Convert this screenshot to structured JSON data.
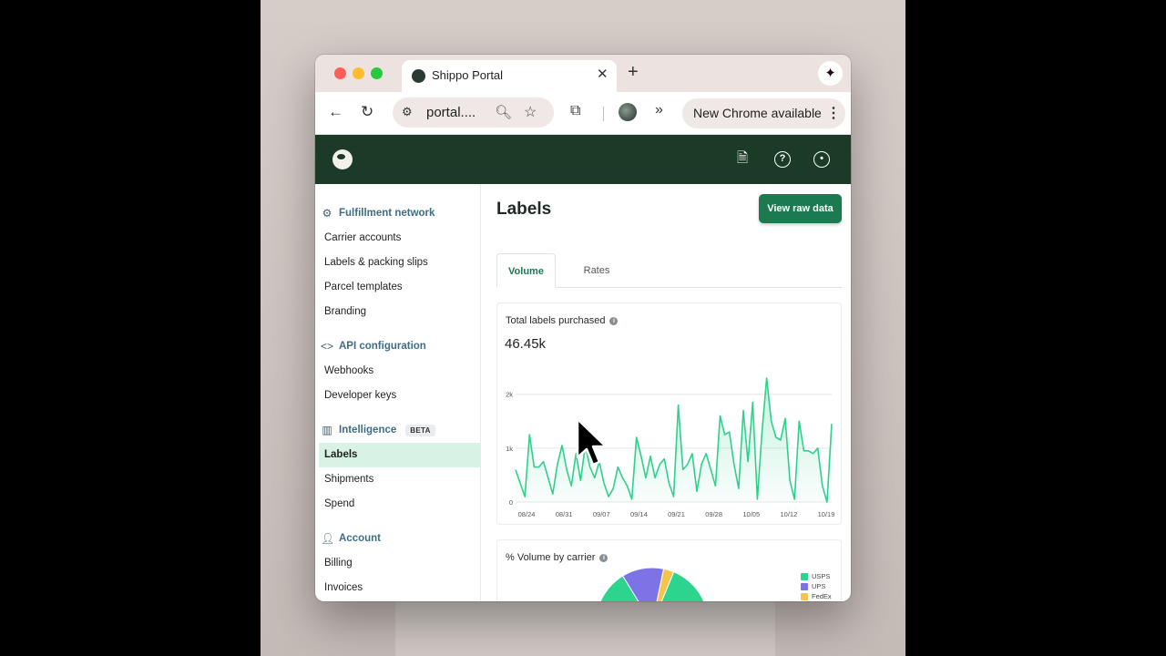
{
  "browser": {
    "tab_title": "Shippo Portal",
    "tab_close": "✕",
    "new_tab": "+",
    "url": "portal....",
    "update_pill": "New Chrome available",
    "menu": "⋮"
  },
  "sidebar": {
    "sections": [
      {
        "label": "Fulfillment network",
        "items": [
          "Carrier accounts",
          "Labels & packing slips",
          "Parcel templates",
          "Branding"
        ]
      },
      {
        "label": "API configuration",
        "items": [
          "Webhooks",
          "Developer keys"
        ]
      },
      {
        "label": "Intelligence",
        "badge": "BETA",
        "items": [
          "Labels",
          "Shipments",
          "Spend"
        ]
      },
      {
        "label": "Account",
        "items": [
          "Billing",
          "Invoices"
        ]
      }
    ],
    "active_item": "Labels"
  },
  "main": {
    "title": "Labels",
    "view_raw_button": "View raw data",
    "tabs": [
      "Volume",
      "Rates"
    ],
    "active_tab": "Volume"
  },
  "chart_card": {
    "title": "Total labels purchased",
    "total": "46.45k"
  },
  "carrier_card": {
    "title": "% Volume by carrier"
  },
  "chart_data": [
    {
      "type": "area",
      "title": "Total labels purchased",
      "x_tick_labels": [
        "08/24",
        "08/31",
        "09/07",
        "09/14",
        "09/21",
        "09/28",
        "10/05",
        "10/12",
        "10/19"
      ],
      "y_tick_labels": [
        "0",
        "1k",
        "2k"
      ],
      "ylim": [
        0,
        2300
      ],
      "grid": true,
      "color": "#2fd08c",
      "values": [
        600,
        350,
        100,
        1250,
        650,
        650,
        750,
        450,
        150,
        700,
        1050,
        600,
        300,
        900,
        400,
        1050,
        650,
        450,
        750,
        350,
        100,
        250,
        650,
        450,
        300,
        50,
        1200,
        850,
        450,
        850,
        450,
        700,
        800,
        350,
        100,
        1800,
        600,
        700,
        900,
        200,
        700,
        900,
        600,
        300,
        1600,
        1250,
        1300,
        700,
        250,
        1700,
        750,
        1850,
        50,
        1300,
        2300,
        1500,
        1200,
        1150,
        1550,
        400,
        50,
        1500,
        950,
        950,
        900,
        1000,
        300,
        0,
        1450
      ],
      "series": [
        {
          "values_ref": "values"
        }
      ]
    },
    {
      "type": "pie",
      "title": "% Volume by carrier",
      "legend": [
        "USPS",
        "UPS",
        "FedEx"
      ],
      "colors": [
        "#2dd48e",
        "#7b73e6",
        "#f5c54a"
      ],
      "values": [
        85,
        12,
        3
      ],
      "legend_position": "right"
    }
  ]
}
